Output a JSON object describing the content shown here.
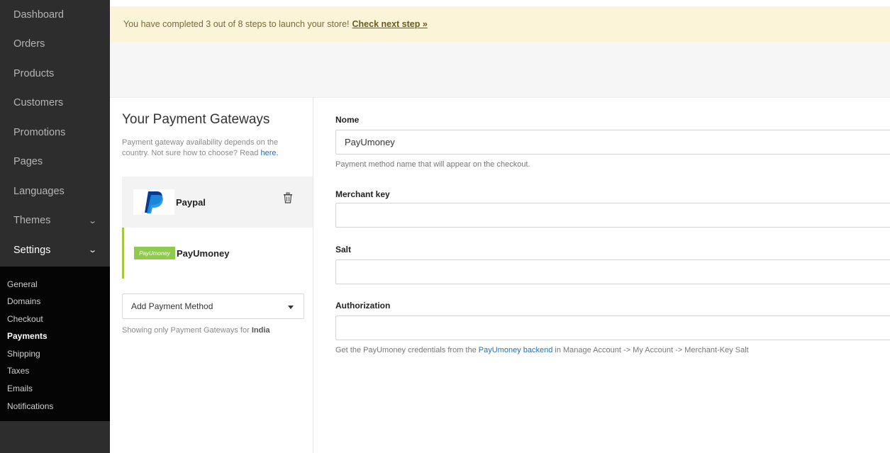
{
  "sidebar": {
    "items": [
      {
        "label": "Dashboard"
      },
      {
        "label": "Orders"
      },
      {
        "label": "Products"
      },
      {
        "label": "Customers"
      },
      {
        "label": "Promotions"
      },
      {
        "label": "Pages"
      },
      {
        "label": "Languages"
      },
      {
        "label": "Themes"
      },
      {
        "label": "Settings"
      }
    ],
    "sub_items": [
      {
        "label": "General"
      },
      {
        "label": "Domains"
      },
      {
        "label": "Checkout"
      },
      {
        "label": "Payments"
      },
      {
        "label": "Shipping"
      },
      {
        "label": "Taxes"
      },
      {
        "label": "Emails"
      },
      {
        "label": "Notifications"
      }
    ]
  },
  "banner": {
    "text": "You have completed 3 out of 8 steps to launch your store!",
    "link": "Check next step »"
  },
  "gateways": {
    "title": "Your Payment Gateways",
    "desc": "Payment gateway availability depends on the country. Not sure how to choose? Read",
    "desc_link": "here.",
    "items": [
      {
        "name": "Paypal"
      },
      {
        "name": "PayUmoney",
        "logo_text": "PayUmoney"
      }
    ],
    "add_method": "Add Payment Method",
    "note_prefix": "Showing only Payment Gateways for",
    "note_country": "India"
  },
  "form": {
    "name_label": "Nome",
    "name_value": "PayUmoney",
    "name_help": "Payment method name that will appear on the checkout.",
    "merchant_label": "Merchant key",
    "merchant_value": "",
    "salt_label": "Salt",
    "salt_value": "",
    "auth_label": "Authorization",
    "auth_value": "",
    "help_prefix": "Get the PayUmoney credentials from the",
    "help_link": "PayUmoney backend",
    "help_suffix": "in Manage Account -> My Account -> Merchant-Key Salt"
  },
  "colors": {
    "sidebar_bg": "#2d2d2d",
    "banner_bg": "#fbf4d9",
    "accent": "#a8c63c",
    "link": "#2a6fb0"
  }
}
